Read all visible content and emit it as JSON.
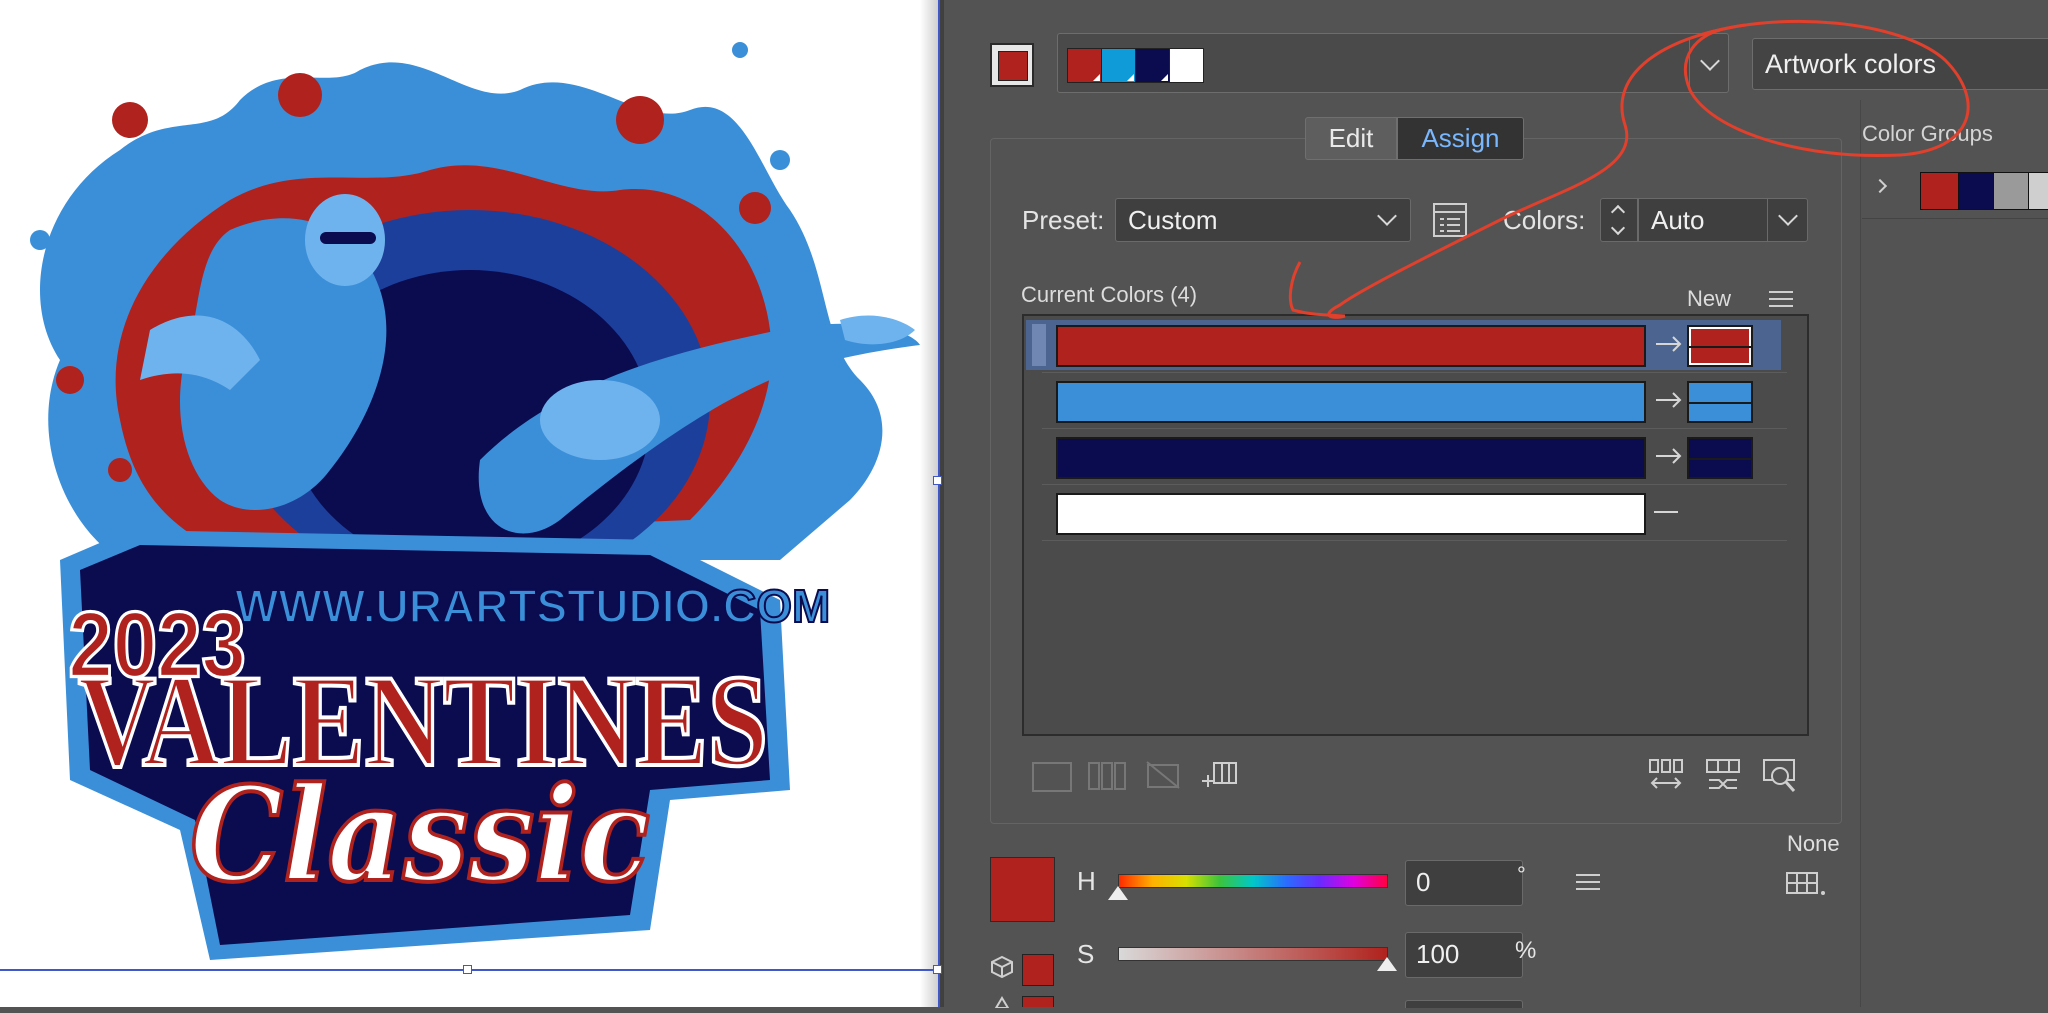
{
  "artwork": {
    "year": "2023",
    "url": "WWW.URARTSTUDIO.COM",
    "title_line1": "VALENTINES",
    "title_line2": "Classic"
  },
  "colors": {
    "red": "#b0221d",
    "light_blue": "#3b8fd8",
    "navy": "#0b0b50",
    "white": "#ffffff",
    "accent_tab": "#79b7ff",
    "annotation": "#e0402c"
  },
  "panel": {
    "group_dropdown_value": "Artwork colors",
    "tabs": {
      "edit": "Edit",
      "assign": "Assign"
    },
    "preset_label": "Preset:",
    "preset_value": "Custom",
    "colors_label": "Colors:",
    "colors_value": "Auto",
    "current_colors_label": "Current Colors (4)",
    "new_label": "New",
    "color_groups_label": "Color Groups",
    "none_label": "None",
    "rows": [
      {
        "current": "red",
        "new": "red",
        "mapped": true,
        "selected": true
      },
      {
        "current": "light_blue",
        "new": "light_blue",
        "mapped": true,
        "selected": false
      },
      {
        "current": "navy",
        "new": "navy",
        "mapped": true,
        "selected": false
      },
      {
        "current": "white",
        "new": null,
        "mapped": false,
        "selected": false
      }
    ],
    "sliders": [
      {
        "label": "H",
        "value": "0",
        "unit": "°"
      },
      {
        "label": "S",
        "value": "100",
        "unit": "%"
      }
    ]
  }
}
